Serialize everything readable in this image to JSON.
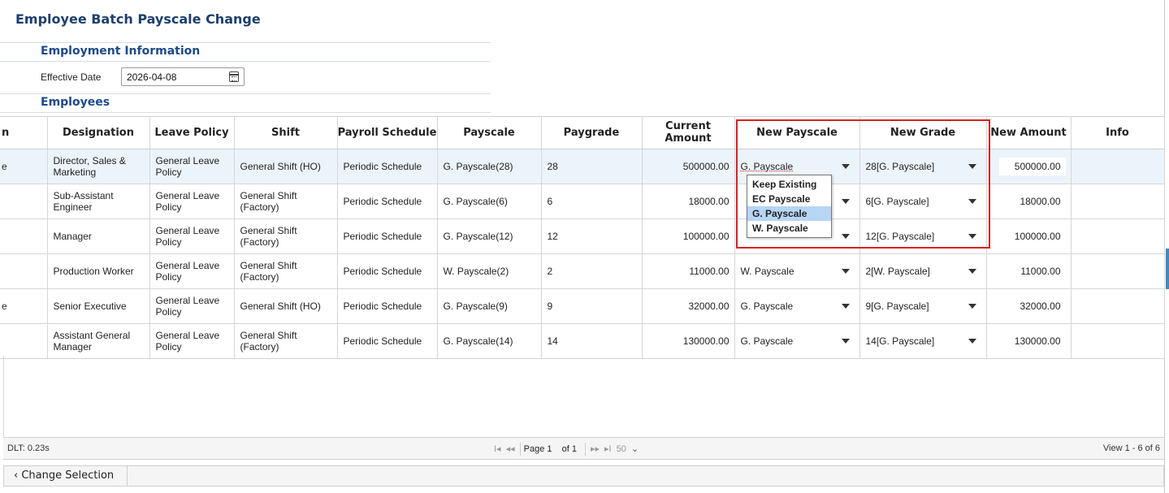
{
  "page_title": "Employee Batch Payscale Change",
  "employment_section": {
    "title": "Employment Information",
    "effective_date_label": "Effective Date",
    "effective_date_value": "2026-04-08",
    "icon": "calendar-icon"
  },
  "employees_section": {
    "title": "Employees"
  },
  "table": {
    "columns": [
      "n",
      "Designation",
      "Leave Policy",
      "Shift",
      "Payroll Schedule",
      "Payscale",
      "Paygrade",
      "Current Amount",
      "New Payscale",
      "New Grade",
      "New Amount",
      "Info"
    ],
    "rows": [
      {
        "lead": "e",
        "designation": "Director, Sales & Marketing",
        "leave_policy": "General Leave Policy",
        "shift": "General Shift (HO)",
        "payroll_schedule": "Periodic Schedule",
        "payscale": "G. Payscale(28)",
        "paygrade": "28",
        "current_amount": "500000.00",
        "new_payscale": "G. Payscale",
        "new_grade": "28[G. Payscale]",
        "new_amount": "500000.00",
        "info": ""
      },
      {
        "lead": "",
        "designation": "Sub-Assistant Engineer",
        "leave_policy": "General Leave Policy",
        "shift": "General Shift (Factory)",
        "payroll_schedule": "Periodic Schedule",
        "payscale": "G. Payscale(6)",
        "paygrade": "6",
        "current_amount": "18000.00",
        "new_payscale": "",
        "new_grade": "6[G. Payscale]",
        "new_amount": "18000.00",
        "info": ""
      },
      {
        "lead": "",
        "designation": "Manager",
        "leave_policy": "General Leave Policy",
        "shift": "General Shift (Factory)",
        "payroll_schedule": "Periodic Schedule",
        "payscale": "G. Payscale(12)",
        "paygrade": "12",
        "current_amount": "100000.00",
        "new_payscale": "",
        "new_grade": "12[G. Payscale]",
        "new_amount": "100000.00",
        "info": ""
      },
      {
        "lead": "",
        "designation": "Production Worker",
        "leave_policy": "General Leave Policy",
        "shift": "General Shift (Factory)",
        "payroll_schedule": "Periodic Schedule",
        "payscale": "W. Payscale(2)",
        "paygrade": "2",
        "current_amount": "11000.00",
        "new_payscale": "W. Payscale",
        "new_grade": "2[W. Payscale]",
        "new_amount": "11000.00",
        "info": ""
      },
      {
        "lead": "e",
        "designation": "Senior Executive",
        "leave_policy": "General Leave Policy",
        "shift": "General Shift (HO)",
        "payroll_schedule": "Periodic Schedule",
        "payscale": "G. Payscale(9)",
        "paygrade": "9",
        "current_amount": "32000.00",
        "new_payscale": "G. Payscale",
        "new_grade": "9[G. Payscale]",
        "new_amount": "32000.00",
        "info": ""
      },
      {
        "lead": "",
        "designation": "Assistant General Manager",
        "leave_policy": "General Leave Policy",
        "shift": "General Shift (Factory)",
        "payroll_schedule": "Periodic Schedule",
        "payscale": "G. Payscale(14)",
        "paygrade": "14",
        "current_amount": "130000.00",
        "new_payscale": "G. Payscale",
        "new_grade": "14[G. Payscale]",
        "new_amount": "130000.00",
        "info": ""
      }
    ]
  },
  "payscale_dropdown": {
    "options": [
      "Keep Existing",
      "EC Payscale",
      "G. Payscale",
      "W. Payscale"
    ],
    "active": "G. Payscale"
  },
  "footer": {
    "dlt": "DLT: 0.23s",
    "first_icon": "I◂",
    "prev_icon": "◂◂",
    "page_label": "Page 1",
    "of_label": "of 1",
    "next_icon": "▸▸",
    "last_icon": "▸I",
    "page_size": "50",
    "view": "View 1 - 6 of 6"
  },
  "change_selection": {
    "arrow": "‹",
    "label": "Change Selection"
  },
  "colors": {
    "title": "#1c3f6e",
    "section": "#1c4a8c",
    "selected_row": "#ecf4fb",
    "highlight_border": "#d82121",
    "dropdown_active": "#b7d5f5"
  }
}
